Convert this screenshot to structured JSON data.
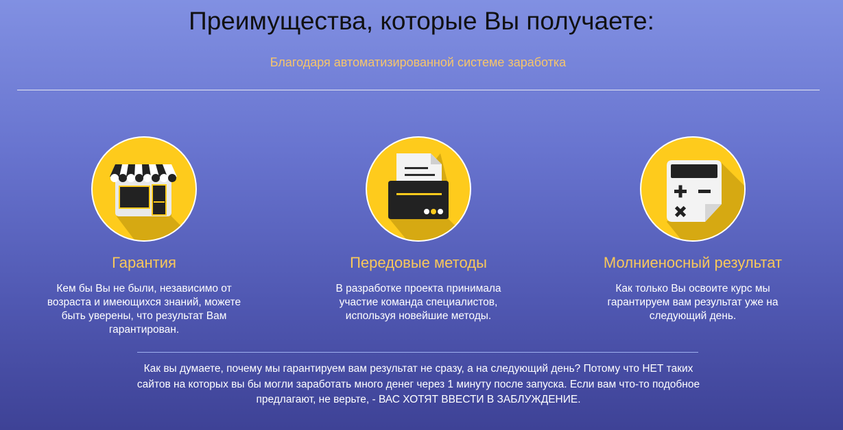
{
  "header": {
    "title": "Преимущества, которые Вы получаете:",
    "subtitle": "Благодаря автоматизированной системе заработка"
  },
  "features": [
    {
      "icon": "shop-icon",
      "title": "Гарантия",
      "text": "Кем бы Вы не были, независимо от возраста и имеющихся знаний, можете быть уверены, что результат Вам гарантирован."
    },
    {
      "icon": "printer-icon",
      "title": "Передовые методы",
      "text": "В разработке проекта принимала участие команда специалистов, используя новейшие методы."
    },
    {
      "icon": "calculator-icon",
      "title": "Молниеносный результат",
      "text": "Как только Вы освоите курс мы гарантируем вам результат уже на следующий день."
    }
  ],
  "note": "Как вы думаете, почему мы гарантируем вам результат не сразу, а на следующий день? Потому что НЕТ таких сайтов на которых вы бы могли заработать много денег через 1 минуту после запуска. Если вам что-то подобное предлагают, не верьте, - ВАС ХОТЯТ ВВЕСТИ В ЗАБЛУЖДЕНИЕ.",
  "colors": {
    "accent": "#f9c85a",
    "icon_circle": "#fecb1c",
    "icon_shadow": "#d6a912"
  }
}
